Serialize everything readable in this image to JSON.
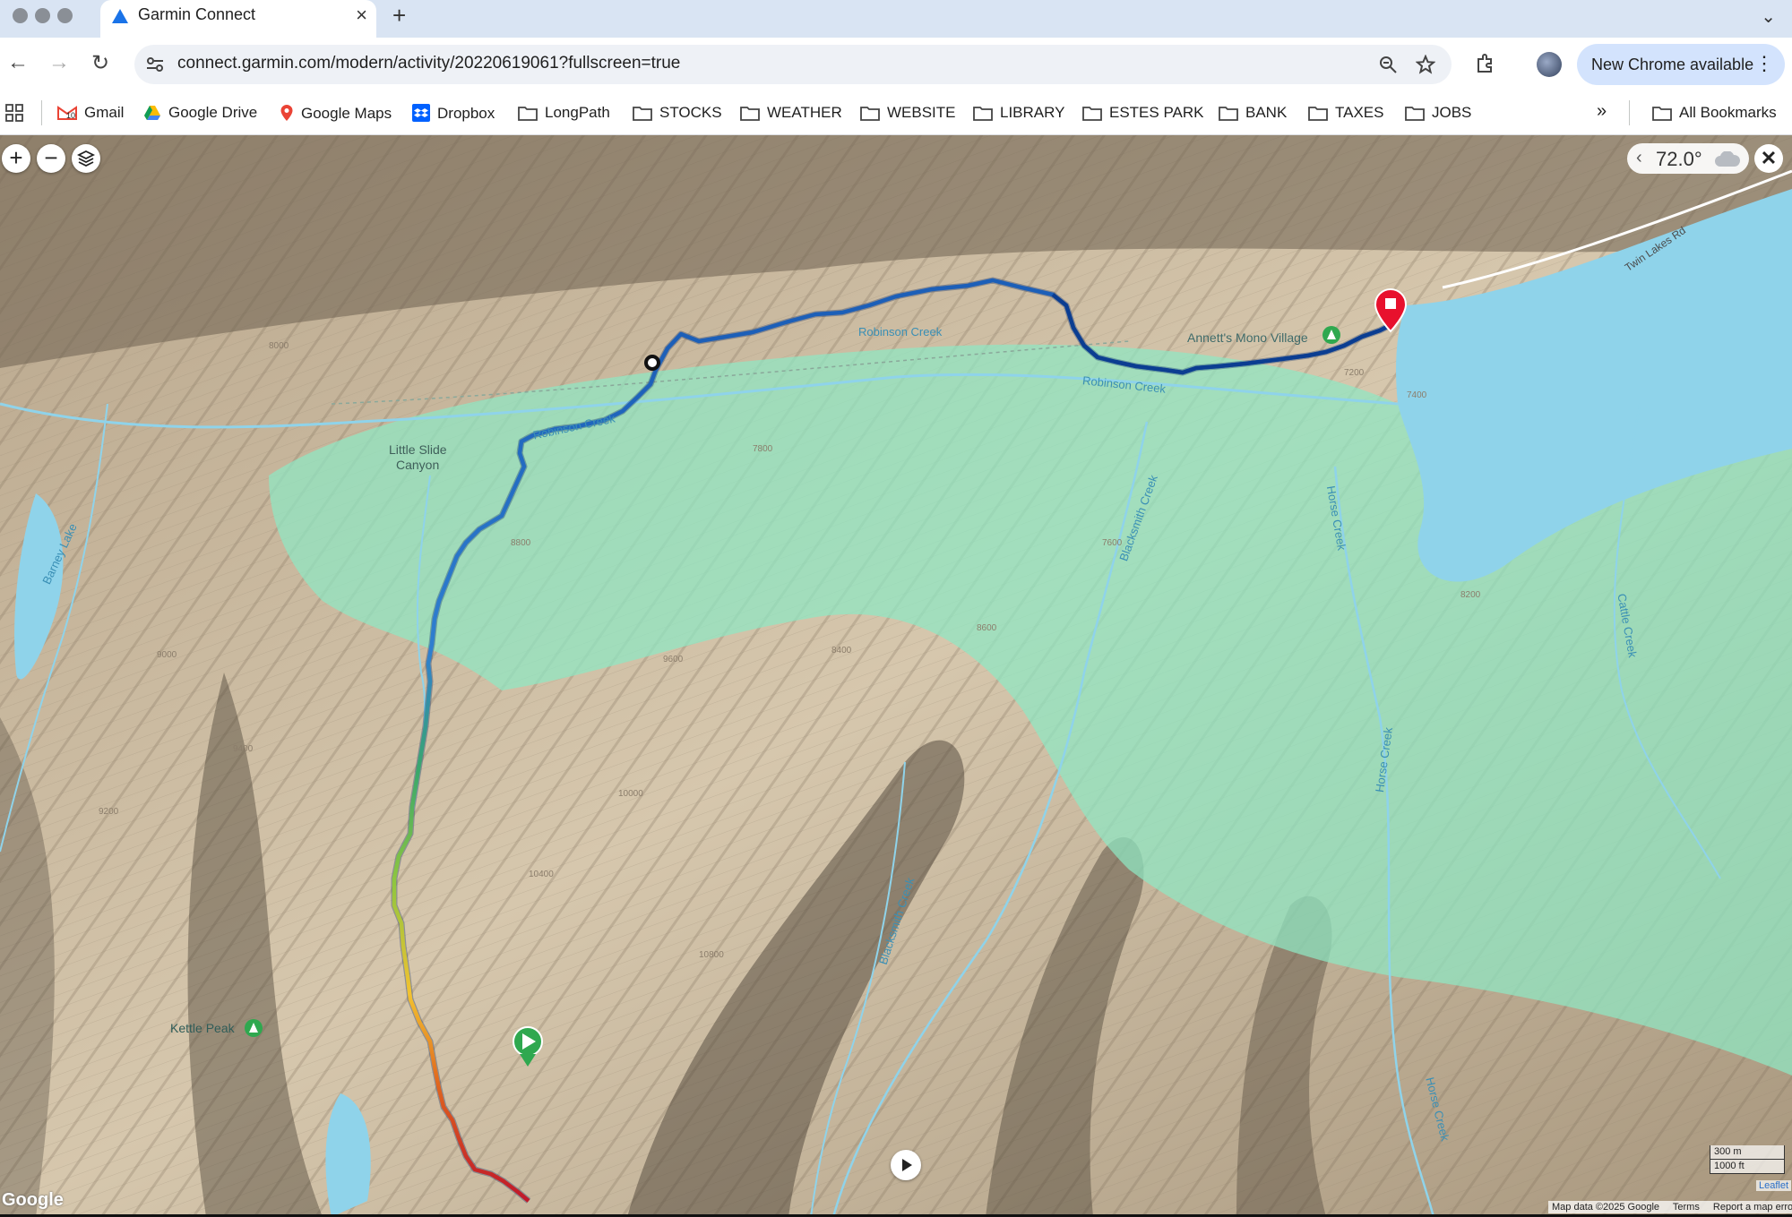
{
  "browser": {
    "tab_title": "Garmin Connect",
    "url": "connect.garmin.com/modern/activity/20220619061?fullscreen=true",
    "update_label": "New Chrome available",
    "bookmarks": [
      {
        "label": "Gmail",
        "icon": "gmail-icon"
      },
      {
        "label": "Google Drive",
        "icon": "google-drive-icon"
      },
      {
        "label": "Google Maps",
        "icon": "google-maps-icon"
      },
      {
        "label": "Dropbox",
        "icon": "dropbox-icon"
      },
      {
        "label": "LongPath",
        "icon": "folder-icon"
      },
      {
        "label": "STOCKS",
        "icon": "folder-icon"
      },
      {
        "label": "WEATHER",
        "icon": "folder-icon"
      },
      {
        "label": "WEBSITE",
        "icon": "folder-icon"
      },
      {
        "label": "LIBRARY",
        "icon": "folder-icon"
      },
      {
        "label": "ESTES PARK",
        "icon": "folder-icon"
      },
      {
        "label": "BANK",
        "icon": "folder-icon"
      },
      {
        "label": "TAXES",
        "icon": "folder-icon"
      },
      {
        "label": "JOBS",
        "icon": "folder-icon"
      }
    ],
    "all_bookmarks_label": "All Bookmarks",
    "gmail_badge": "10"
  },
  "map": {
    "weather": {
      "temperature": "72.0°",
      "icon": "cloud-icon"
    },
    "labels": {
      "annetts": "Annett's Mono Village",
      "little_slide": "Little Slide",
      "little_slide_2": "Canyon",
      "kettle_peak": "Kettle Peak",
      "barney_lake": "Barney Lake",
      "twin_lakes_rd": "Twin Lakes Rd",
      "robinson_creek_1": "Robinson Creek",
      "robinson_creek_2": "Robinson Creek",
      "robinson_creek_3": "Robinson Creek",
      "blacksmith_creek_1": "Blacksmith Creek",
      "blacksmith_creek_2": "Blacksmith Creek",
      "horse_creek_1": "Horse Creek",
      "horse_creek_2": "Horse Creek",
      "horse_creek_3": "Horse Creek",
      "cattle_creek": "Cattle Creek"
    },
    "contours": [
      "7600",
      "7800",
      "8000",
      "8200",
      "8400",
      "8600",
      "8800",
      "9000",
      "9200",
      "9400",
      "9600",
      "10000",
      "10400",
      "10800",
      "7200",
      "7400"
    ],
    "scale": {
      "metric": "300 m",
      "imperial": "1000 ft"
    },
    "attribution": {
      "leaflet": "Leaflet",
      "data": "Map data ©2025 Google",
      "terms": "Terms",
      "report": "Report a map error",
      "google": "Google"
    },
    "colors": {
      "track_start": "#c0182a",
      "track_mid": "#8dc63f",
      "track_end": "#0b3d91",
      "green_zone": "#8fe8c4",
      "water": "#8fd3ea",
      "start_marker": "#2fa84f",
      "end_marker": "#e8112d"
    }
  }
}
